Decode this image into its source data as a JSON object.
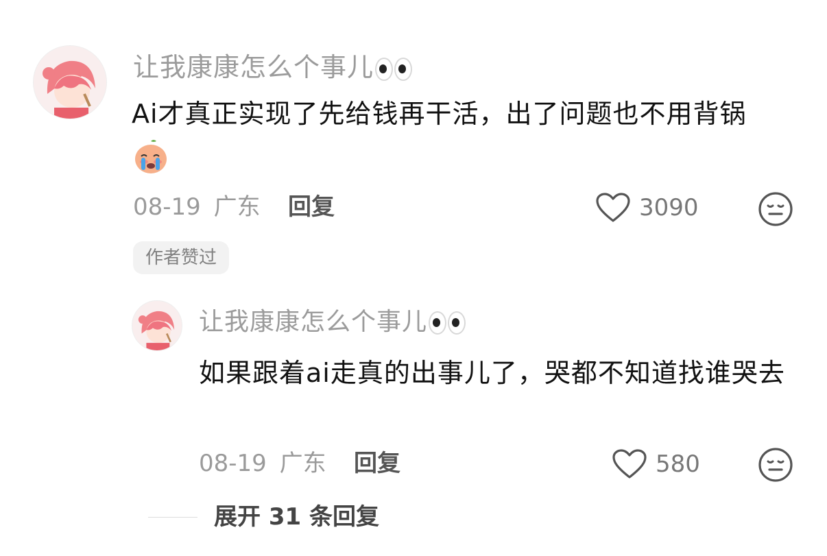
{
  "comment": {
    "username": "让我康康怎么个事儿",
    "username_emoji": "eyes-emoji",
    "text": "Ai才真正实现了先给钱再干活，出了问题也不用背锅",
    "emoji": "crying-face-emoji",
    "date": "08-19",
    "location": "广东",
    "reply_label": "回复",
    "like_count": "3090",
    "author_liked_label": "作者赞过"
  },
  "reply": {
    "username": "让我康康怎么个事儿",
    "username_emoji": "eyes-emoji",
    "text": "如果跟着ai走真的出事儿了，哭都不知道找谁哭去",
    "date": "08-19",
    "location": "广东",
    "reply_label": "回复",
    "like_count": "580"
  },
  "expand": {
    "label": "展开 31 条回复"
  },
  "icons": {
    "like": "heart-outline-icon",
    "dislike": "neutral-face-icon"
  },
  "colors": {
    "text_primary": "#111111",
    "text_secondary": "#9b9b9b",
    "badge_bg": "#f2f2f2",
    "avatar_hair": "#f08a8a"
  }
}
